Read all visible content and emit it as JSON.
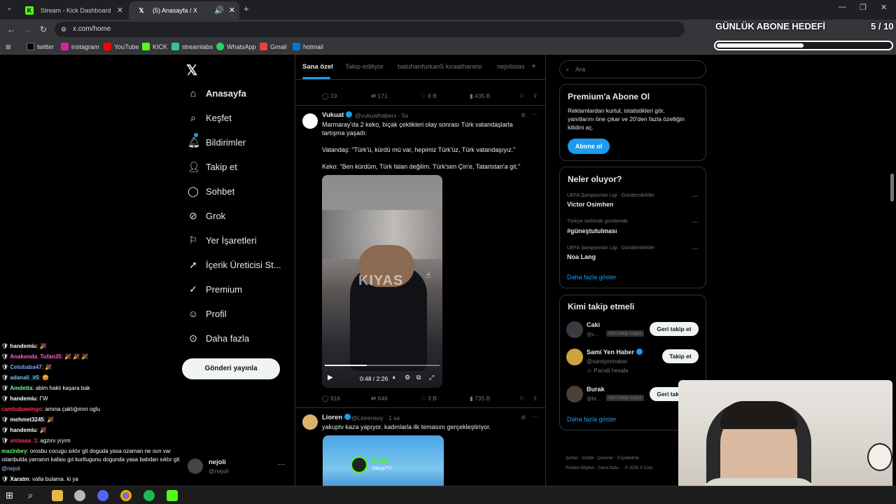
{
  "browser": {
    "tabs": [
      {
        "label": "Stream - Kick Dashboard",
        "icon": "kick-icon"
      },
      {
        "label": "(5) Anasayfa / X",
        "icon": "x-logo-icon"
      }
    ],
    "url": "x.com/home",
    "bookmarks": [
      "twitter",
      "instagram",
      "YouTube",
      "KICK",
      "streamlabs",
      "WhatsApp",
      "Gmail",
      "hotmail"
    ]
  },
  "overlay": {
    "goal_title": "GÜNLÜK ABONE HEDEFİ",
    "goal_count": "5 / 10",
    "goal_progress": 0.5
  },
  "sidebar": {
    "items": [
      {
        "label": "Anasayfa",
        "icon": "home-icon"
      },
      {
        "label": "Keşfet",
        "icon": "search-icon"
      },
      {
        "label": "Bildirimler",
        "icon": "bell-icon"
      },
      {
        "label": "Takip et",
        "icon": "add-user-icon"
      },
      {
        "label": "Sohbet",
        "icon": "chat-bubble-icon"
      },
      {
        "label": "Grok",
        "icon": "grok-icon"
      },
      {
        "label": "Yer İşaretleri",
        "icon": "bookmark-icon"
      },
      {
        "label": "İçerik Üreticisi St...",
        "icon": "rocket-icon"
      },
      {
        "label": "Premium",
        "icon": "premium-check-icon"
      },
      {
        "label": "Profil",
        "icon": "profile-icon"
      },
      {
        "label": "Daha fazla",
        "icon": "more-circle-icon"
      }
    ],
    "post_button": "Gönderi yayınla",
    "account": {
      "name": "nejoli",
      "handle": "@nejoli"
    }
  },
  "timeline": {
    "tabs": [
      "Sana özel",
      "Takip ediliyor",
      "batuhanfurkan5 kıraathanesi",
      "nejolistas"
    ],
    "top_stats": {
      "replies": "19",
      "reposts": "171",
      "likes": "8 B",
      "views": "435 B"
    },
    "tweet1": {
      "name": "Vukuat",
      "handle": "@vukuathaberx · 5s",
      "lines": [
        "Marmaray'da 2 keko, bıçak çektikleri olay sonrası Türk vatandaşlarla",
        "tartışma yaşadı:",
        "Vatandaş: \"Türk'ü, kürdü mü var, hepimiz Türk'üz, Türk vatandaşıyız.\"",
        "Keko: \"Ben kürdüm, Türk falan değilim. Türk'sen Çin'e, Tataristan'a git.\""
      ],
      "video_watermark": "KIYAS",
      "video_time": "0:48 / 2:26",
      "video_progress": 0.367,
      "stats": {
        "replies": "916",
        "reposts": "646",
        "likes": "3 B",
        "views": "735 B"
      }
    },
    "tweet2": {
      "name": "Lioren",
      "handle": "@Liorensuy · 1 sa",
      "text": "yakuptv kaza yapıyor. kadınlarla ilk temasını gerçekleştiriyor.",
      "media_label": "KICK",
      "media_sub": "YakupTV"
    }
  },
  "right": {
    "search_placeholder": "Ara",
    "premium": {
      "title": "Premium'a Abone Ol",
      "lines": [
        "Reklamlardan kurtul, istatistikleri gör,",
        "yanıtlarını öne çıkar ve 20'den fazla özelliğin",
        "kilidini aç."
      ],
      "button": "Abone ol"
    },
    "trends": {
      "title": "Neler oluyor?",
      "items": [
        {
          "context": "UEFA Şampiyonlar Ligi · Gündemdekiler",
          "name": "Victor Osimhen"
        },
        {
          "context": "Türkiye tarihinde gündemde",
          "name": "#güneştutulması"
        },
        {
          "context": "UEFA Şampiyonlar Ligi · Gündemdekiler",
          "name": "Noa Lang"
        }
      ],
      "more": "Daha fazla göster"
    },
    "follow": {
      "title": "Kimi takip etmeli",
      "items": [
        {
          "name": "Caki",
          "handle": "@c...",
          "badge": "Seni takip ediyor",
          "button": "Geri takip et"
        },
        {
          "name": "Sami Yen Haber",
          "handle": "@samiyenhaber",
          "badge": "Parodi hesabı",
          "button": "Takip et"
        },
        {
          "name": "Burak",
          "handle": "@br...",
          "badge": "Seni takip ediyor",
          "button": "Geri takip et"
        }
      ],
      "more": "Daha fazla göster"
    },
    "footer_lines": [
      "Şartlar · Gizlilik · Çerezler · Erişilebilirlik",
      "Reklam Bilgileri · Daha fazla ··· © 2026 X Corp."
    ]
  },
  "chat": [
    {
      "user": "handemiu",
      "msg": ": 🎉",
      "color": "#ffffff"
    },
    {
      "user": "Anakonda_Tufan35",
      "msg": ": 🎉 🎉 🎉",
      "color": "#ff66cc"
    },
    {
      "user": "Cetobaba47",
      "msg": ": 🎉",
      "color": "#7fa8ff"
    },
    {
      "user": "adanali_it5",
      "msg": ": 😡",
      "color": "#66ccff"
    },
    {
      "user": "Amdetta",
      "msg": ": abim haklı kaşara bak",
      "color": "#66ff99"
    },
    {
      "user": "handemiu",
      "msg": ": ΓW",
      "color": "#ffffff"
    },
    {
      "user": "cambabawingo",
      "msg": ": amına çaktığımın oglu",
      "color": "#ff3355"
    },
    {
      "user": "mehmet3245",
      "msg": ": 🎉",
      "color": "#ffffff"
    },
    {
      "user": "handemiu",
      "msg": ": 🎉",
      "color": "#ffffff"
    },
    {
      "user": "antaaaa_1",
      "msg": ": agzını yıyım",
      "color": "#ff3355"
    },
    {
      "user": "mazinbey",
      "msg": ": orosbu cocugu sıktır git doguda yasa ozaman ne ısın var",
      "color": "#66ff66"
    },
    {
      "user": "",
      "msg": "ıstanbulda yarranın kafası gıt kurtlugunu dogunda yasa batıdan sıktır git",
      "color": "#ffffff"
    },
    {
      "user": "@nejoli",
      "msg": "",
      "color": "#a0c4ff"
    },
    {
      "user": "Xaratm",
      "msg": ": valla bulama. ki ya",
      "color": "#ffffff"
    }
  ]
}
